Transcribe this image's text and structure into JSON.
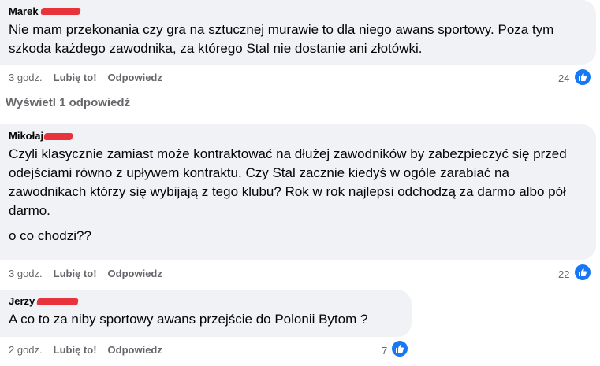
{
  "comments": [
    {
      "author": "Marek",
      "text": [
        "Nie mam przekonania czy gra na sztucznej murawie to dla niego awans sportowy. Poza tym szkoda każdego zawodnika, za którego Stal nie dostanie ani złotówki."
      ],
      "time": "3 godz.",
      "like_label": "Lubię to!",
      "reply_label": "Odpowiedz",
      "reactions": "24"
    },
    {
      "author": "Mikołaj",
      "text": [
        "Czyli klasycznie zamiast może kontraktować na dłużej zawodników by zabezpieczyć się przed odejściami równo z upływem kontraktu. Czy Stal zacznie kiedyś w ogóle zarabiać na zawodnikach którzy się wybijają z tego klubu? Rok w rok najlepsi odchodzą za darmo albo pół darmo.",
        "o co chodzi??"
      ],
      "time": "3 godz.",
      "like_label": "Lubię to!",
      "reply_label": "Odpowiedz",
      "reactions": "22"
    },
    {
      "author": "Jerzy",
      "text": [
        "A co to za niby sportowy awans przejście do Polonii Bytom ?"
      ],
      "time": "2 godz.",
      "like_label": "Lubię to!",
      "reply_label": "Odpowiedz",
      "reactions": "7"
    }
  ],
  "view_replies": "Wyświetl 1 odpowiedź",
  "colors": {
    "bubble": "#f0f2f5",
    "like_blue": "#1877f2",
    "meta": "#65676b",
    "redaction": "#e8323c"
  },
  "icons": {
    "reaction": "thumbs-up-icon"
  }
}
